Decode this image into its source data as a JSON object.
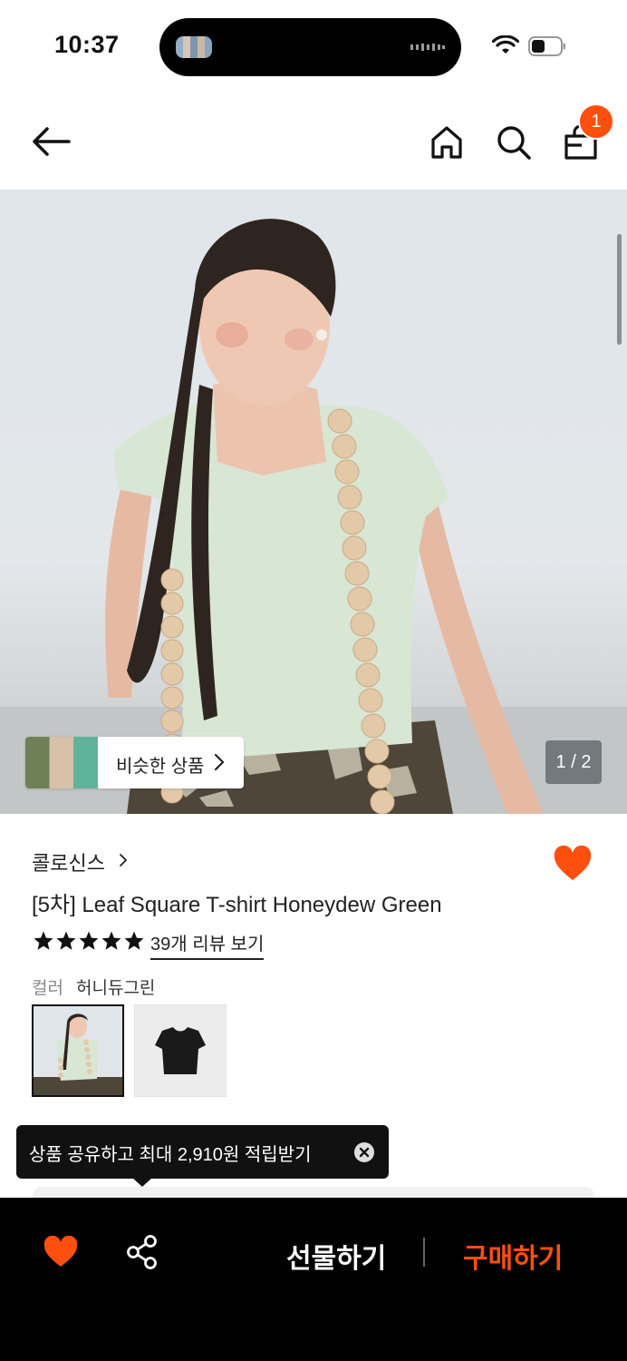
{
  "status_bar": {
    "time": "10:37"
  },
  "nav": {
    "cart_count": "1"
  },
  "gallery": {
    "similar_label": "비슷한 상품",
    "page_indicator": "1 / 2"
  },
  "product": {
    "brand": "콜로신스",
    "title": "[5차] Leaf Square T-shirt Honeydew Green",
    "rating_stars": 5,
    "review_link": "39개 리뷰 보기",
    "color_label": "컬러",
    "color_value": "허니듀그린"
  },
  "share_tooltip": {
    "text": "상품 공유하고 최대 2,910원 적립받기"
  },
  "bottom_bar": {
    "gift_label": "선물하기",
    "buy_label": "구매하기"
  },
  "colors": {
    "accent": "#ff4f0f",
    "bottom_bar_bg": "#000000"
  }
}
